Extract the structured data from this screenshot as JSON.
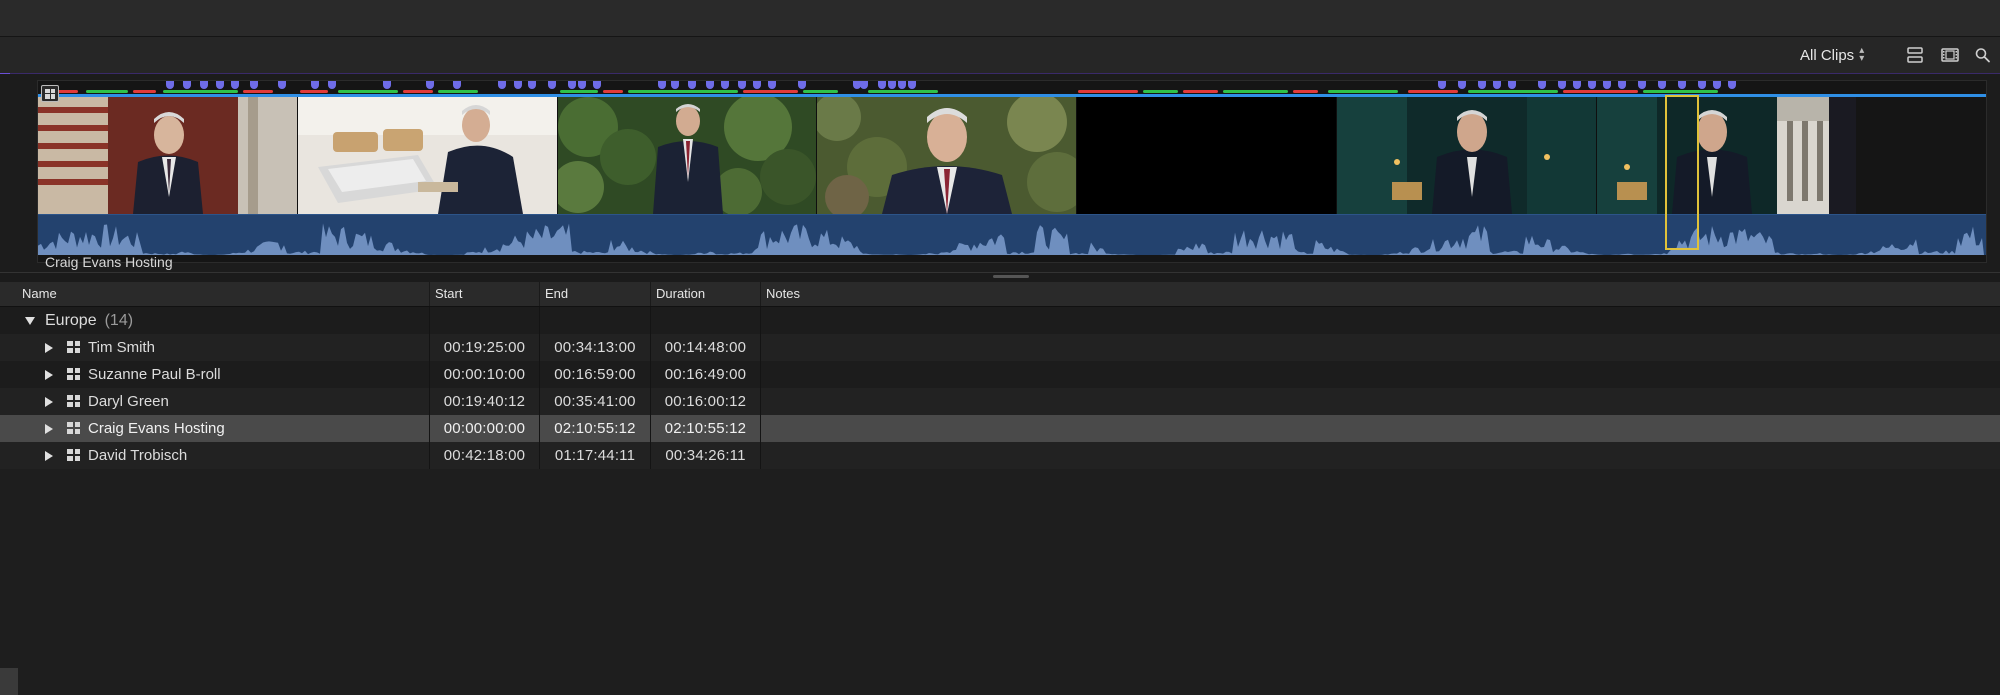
{
  "toolbar": {
    "clips_filter": "All Clips",
    "icons": [
      "clip-appearance-icon",
      "filmstrip-icon",
      "search-icon"
    ]
  },
  "filmstrip": {
    "clip_name": "Craig Evans Hosting",
    "colors": {
      "markers": "#6f6ce8",
      "range_green": "#2fc14a",
      "range_red": "#e03a3a",
      "selection_line": "#2f8fe6",
      "playhead": "#e0c23a",
      "audio": "#23426e"
    }
  },
  "columns": {
    "name": "Name",
    "start": "Start",
    "end": "End",
    "duration": "Duration",
    "notes": "Notes"
  },
  "group": {
    "name": "Europe",
    "count": "(14)"
  },
  "rows": [
    {
      "name": "Tim Smith",
      "start": "00:19:25:00",
      "end": "00:34:13:00",
      "duration": "00:14:48:00"
    },
    {
      "name": "Suzanne Paul B-roll",
      "start": "00:00:10:00",
      "end": "00:16:59:00",
      "duration": "00:16:49:00"
    },
    {
      "name": "Daryl Green",
      "start": "00:19:40:12",
      "end": "00:35:41:00",
      "duration": "00:16:00:12"
    },
    {
      "name": "Craig Evans Hosting",
      "start": "00:00:00:00",
      "end": "02:10:55:12",
      "duration": "02:10:55:12"
    },
    {
      "name": "David Trobisch",
      "start": "00:42:18:00",
      "end": "01:17:44:11",
      "duration": "00:34:26:11"
    }
  ]
}
